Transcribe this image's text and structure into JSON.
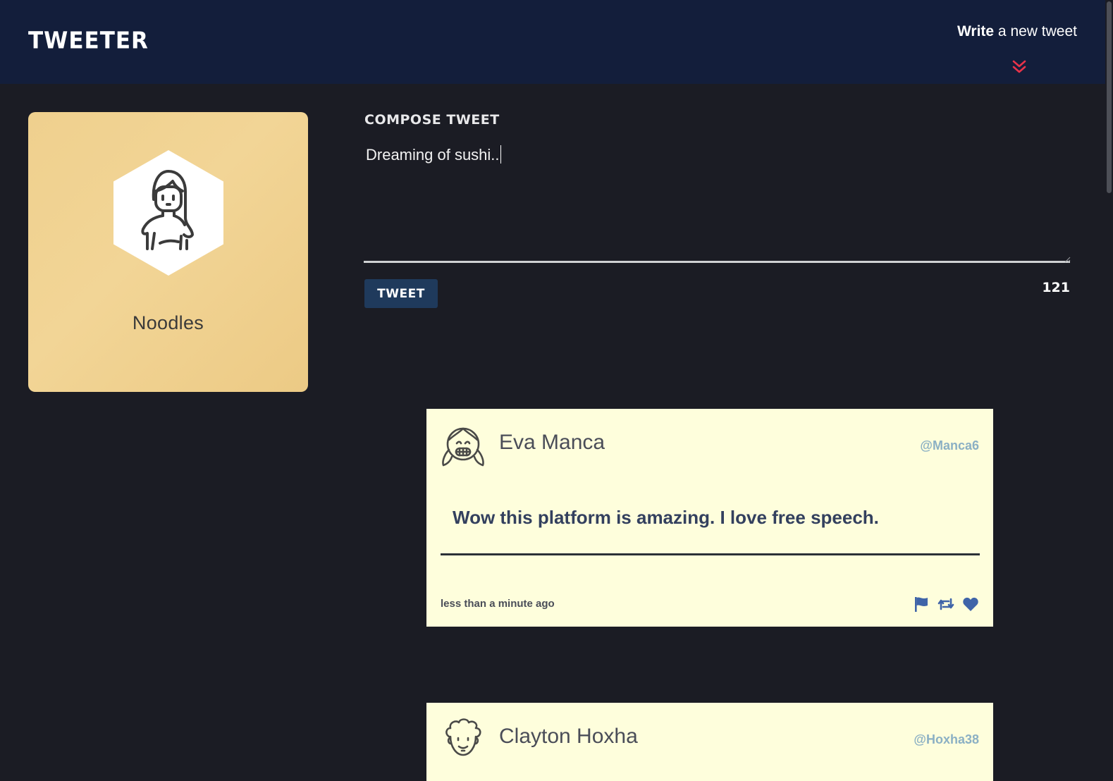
{
  "header": {
    "brand": "Tweeter",
    "write_bold": "Write",
    "write_rest": " a new tweet",
    "accent_color": "#e8334a"
  },
  "profile": {
    "name": "Noodles",
    "avatar_icon": "girl-long-hair-icon"
  },
  "compose": {
    "title": "Compose Tweet",
    "text": "Dreaming of sushi..",
    "button_label": "Tweet",
    "counter": "121"
  },
  "tweets": [
    {
      "author": "Eva Manca",
      "handle": "@Manca6",
      "body": "Wow this platform is amazing. I love free speech.",
      "time": "less than a minute ago",
      "avatar_icon": "girl-pigtails-smile-icon",
      "actions": [
        "flag-icon",
        "retweet-icon",
        "heart-icon"
      ]
    },
    {
      "author": "Clayton Hoxha",
      "handle": "@Hoxha38",
      "avatar_icon": "curly-hair-man-icon"
    }
  ],
  "colors": {
    "header_bg": "#131e3b",
    "page_bg": "#1b1c24",
    "profile_card": "#efd08e",
    "tweet_bg": "#fefedc",
    "button_bg": "#1f3a5c",
    "action_icons": "#3f64a8",
    "handle": "#8bb0c4"
  }
}
